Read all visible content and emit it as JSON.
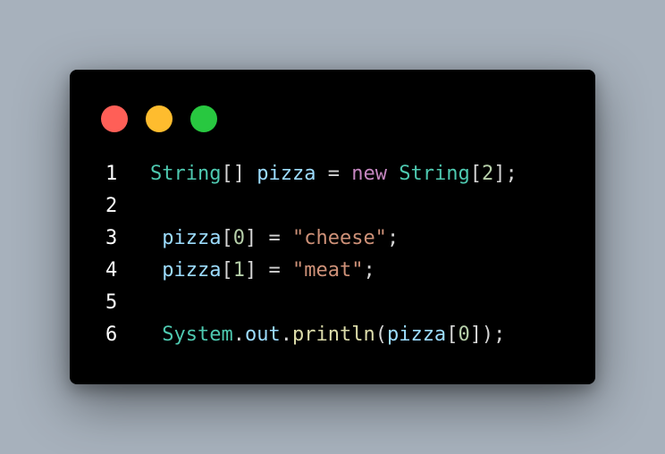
{
  "window": {
    "controls": [
      {
        "name": "close",
        "color": "#ff5f57"
      },
      {
        "name": "minimize",
        "color": "#febc2e"
      },
      {
        "name": "maximize",
        "color": "#28c840"
      }
    ]
  },
  "code": {
    "lines": [
      {
        "number": "1",
        "indent": "",
        "tokens": [
          {
            "text": "String",
            "class": "type"
          },
          {
            "text": "[] ",
            "class": "punc"
          },
          {
            "text": "pizza",
            "class": "var"
          },
          {
            "text": " = ",
            "class": "punc"
          },
          {
            "text": "new",
            "class": "kw"
          },
          {
            "text": " ",
            "class": "punc"
          },
          {
            "text": "String",
            "class": "type"
          },
          {
            "text": "[",
            "class": "punc"
          },
          {
            "text": "2",
            "class": "num"
          },
          {
            "text": "];",
            "class": "punc"
          }
        ]
      },
      {
        "number": "2",
        "indent": "",
        "tokens": []
      },
      {
        "number": "3",
        "indent": " ",
        "tokens": [
          {
            "text": "pizza",
            "class": "var"
          },
          {
            "text": "[",
            "class": "punc"
          },
          {
            "text": "0",
            "class": "num"
          },
          {
            "text": "] = ",
            "class": "punc"
          },
          {
            "text": "\"cheese\"",
            "class": "str"
          },
          {
            "text": ";",
            "class": "punc"
          }
        ]
      },
      {
        "number": "4",
        "indent": " ",
        "tokens": [
          {
            "text": "pizza",
            "class": "var"
          },
          {
            "text": "[",
            "class": "punc"
          },
          {
            "text": "1",
            "class": "num"
          },
          {
            "text": "] = ",
            "class": "punc"
          },
          {
            "text": "\"meat\"",
            "class": "str"
          },
          {
            "text": ";",
            "class": "punc"
          }
        ]
      },
      {
        "number": "5",
        "indent": "",
        "tokens": []
      },
      {
        "number": "6",
        "indent": " ",
        "tokens": [
          {
            "text": "System",
            "class": "type"
          },
          {
            "text": ".",
            "class": "punc"
          },
          {
            "text": "out",
            "class": "var"
          },
          {
            "text": ".",
            "class": "punc"
          },
          {
            "text": "println",
            "class": "fn"
          },
          {
            "text": "(",
            "class": "punc"
          },
          {
            "text": "pizza",
            "class": "var"
          },
          {
            "text": "[",
            "class": "punc"
          },
          {
            "text": "0",
            "class": "num"
          },
          {
            "text": "]);",
            "class": "punc"
          }
        ]
      }
    ]
  }
}
